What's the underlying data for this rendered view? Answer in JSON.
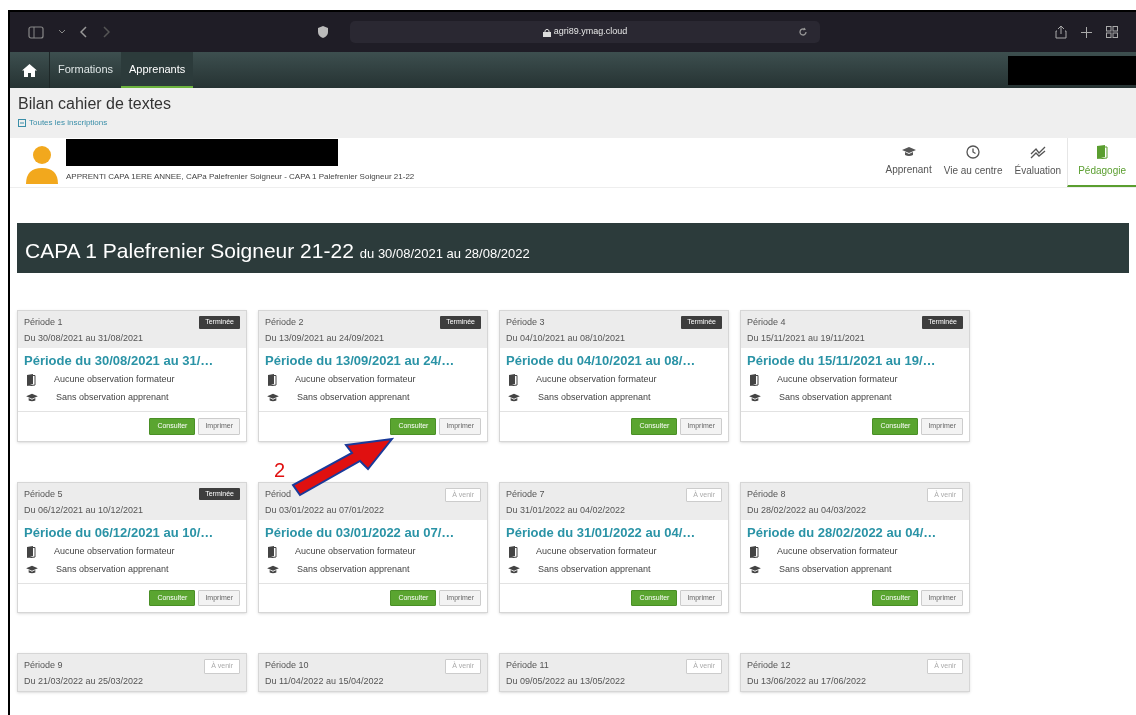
{
  "browser": {
    "url": "agri89.ymag.cloud"
  },
  "nav": {
    "items": [
      {
        "label": "Formations",
        "selected": false
      },
      {
        "label": "Apprenants",
        "selected": true
      }
    ]
  },
  "header": {
    "title": "Bilan cahier de textes",
    "link": "Toutes les inscriptions"
  },
  "student": {
    "subtitle": "APPRENTI CAPA 1ERE ANNEE, CAPa Palefrenier Soigneur - CAPA 1 Palefrenier Soigneur 21-22"
  },
  "tabs": [
    {
      "label": "Apprenant",
      "selected": false
    },
    {
      "label": "Vie au centre",
      "selected": false
    },
    {
      "label": "Évaluation",
      "selected": false
    },
    {
      "label": "Pédagogie",
      "selected": true
    }
  ],
  "banner": {
    "title": "CAPA 1 Palefrenier Soigneur 21-22",
    "dates": "du 30/08/2021 au 28/08/2022"
  },
  "periods": [
    {
      "name": "Période 1",
      "range": "Du 30/08/2021 au 31/08/2021",
      "status": "Terminée",
      "done": true,
      "title": "Période du 30/08/2021 au 31/…",
      "lines": [
        "Aucune observation formateur",
        "Sans observation apprenant"
      ],
      "buttons": [
        "Consulter",
        "Imprimer"
      ]
    },
    {
      "name": "Période 2",
      "range": "Du 13/09/2021 au 24/09/2021",
      "status": "Terminée",
      "done": true,
      "title": "Période du 13/09/2021 au 24/…",
      "lines": [
        "Aucune observation formateur",
        "Sans observation apprenant"
      ],
      "buttons": [
        "Consulter",
        "Imprimer"
      ]
    },
    {
      "name": "Période 3",
      "range": "Du 04/10/2021 au 08/10/2021",
      "status": "Terminée",
      "done": true,
      "title": "Période du 04/10/2021 au 08/…",
      "lines": [
        "Aucune observation formateur",
        "Sans observation apprenant"
      ],
      "buttons": [
        "Consulter",
        "Imprimer"
      ]
    },
    {
      "name": "Période 4",
      "range": "Du 15/11/2021 au 19/11/2021",
      "status": "Terminée",
      "done": true,
      "title": "Période du 15/11/2021 au 19/…",
      "lines": [
        "Aucune observation formateur",
        "Sans observation apprenant"
      ],
      "buttons": [
        "Consulter",
        "Imprimer"
      ]
    },
    {
      "name": "Période 5",
      "range": "Du 06/12/2021 au 10/12/2021",
      "status": "Terminée",
      "done": true,
      "title": "Période du 06/12/2021 au 10/…",
      "lines": [
        "Aucune observation formateur",
        "Sans observation apprenant"
      ],
      "buttons": [
        "Consulter",
        "Imprimer"
      ]
    },
    {
      "name": "Périod",
      "range": "Du 03/01/2022 au 07/01/2022",
      "status": "À venir",
      "done": false,
      "title": "Période du 03/01/2022 au 07/…",
      "lines": [
        "Aucune observation formateur",
        "Sans observation apprenant"
      ],
      "buttons": [
        "Consulter",
        "Imprimer"
      ]
    },
    {
      "name": "Période 7",
      "range": "Du 31/01/2022 au 04/02/2022",
      "status": "À venir",
      "done": false,
      "title": "Période du 31/01/2022 au 04/…",
      "lines": [
        "Aucune observation formateur",
        "Sans observation apprenant"
      ],
      "buttons": [
        "Consulter",
        "Imprimer"
      ]
    },
    {
      "name": "Période 8",
      "range": "Du 28/02/2022 au 04/03/2022",
      "status": "À venir",
      "done": false,
      "title": "Période du 28/02/2022 au 04/…",
      "lines": [
        "Aucune observation formateur",
        "Sans observation apprenant"
      ],
      "buttons": [
        "Consulter",
        "Imprimer"
      ]
    },
    {
      "name": "Période 9",
      "range": "Du 21/03/2022 au 25/03/2022",
      "status": "À venir",
      "done": false
    },
    {
      "name": "Période 10",
      "range": "Du 11/04/2022 au 15/04/2022",
      "status": "À venir",
      "done": false
    },
    {
      "name": "Période 11",
      "range": "Du 09/05/2022 au 13/05/2022",
      "status": "À venir",
      "done": false
    },
    {
      "name": "Période 12",
      "range": "Du 13/06/2022 au 17/06/2022",
      "status": "À venir",
      "done": false
    }
  ],
  "annotation": {
    "label": "2"
  }
}
